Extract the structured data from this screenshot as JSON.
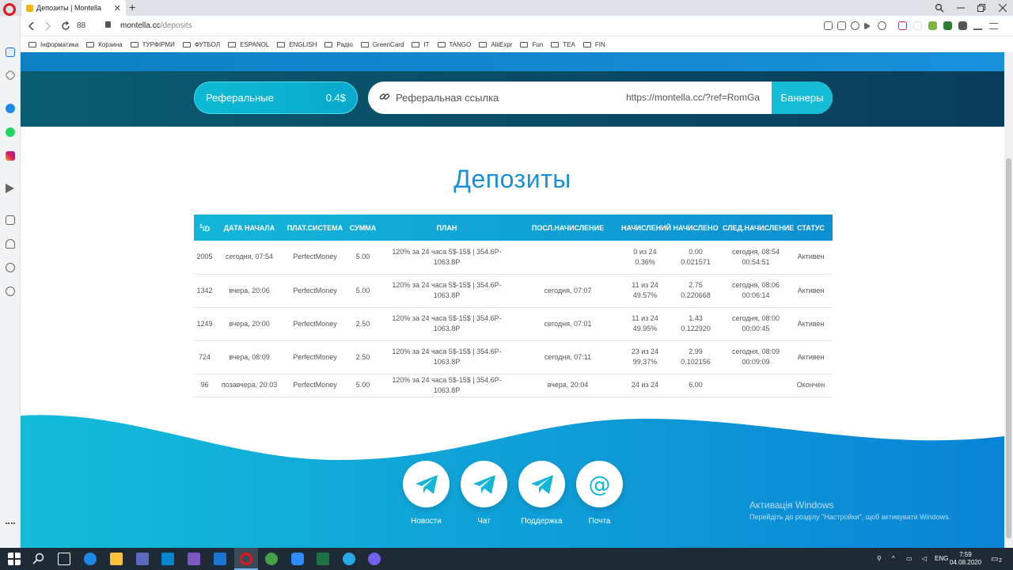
{
  "browser": {
    "tab_title": "Депозиты | Montella",
    "tab_close": "✕",
    "new_tab": "+",
    "speed_dial_count": "88",
    "url_host": "montella.cc",
    "url_path": "/deposits",
    "bookmarks": [
      "Інформатика",
      "Корзина",
      "ТУРФІРМИ",
      "ФУТБОЛ",
      "ESPANOL",
      "ENGLISH",
      "Радіо",
      "GreenCard",
      "IT",
      "TANGO",
      "AliiExpr",
      "Fun",
      "TEA",
      "FIN"
    ]
  },
  "referral": {
    "label": "Реферальные",
    "amount": "0.4$",
    "link_label": "Реферальная ссылка",
    "link_url": "https://montella.cc/?ref=RomGa",
    "banners_label": "Баннеры"
  },
  "page_title": "Депозиты",
  "table": {
    "headers": [
      "ID",
      "ДАТА НАЧАЛА",
      "ПЛАТ.СИСТЕМА",
      "СУММА",
      "ПЛАН",
      "ПОСЛ.НАЧИСЛЕНИЕ",
      "НАЧИСЛЕНИЙ",
      "НАЧИСЛЕНО",
      "СЛЕД.НАЧИСЛЕНИЕ",
      "СТАТУС"
    ],
    "id_prefix": "1",
    "rows": [
      {
        "id": "2005",
        "start": "сегодня, 07:54",
        "system": "PerfectMoney",
        "amount": "5.00",
        "plan": "120% за 24 часа 5$-15$ | 354.6P-1063.8P",
        "last": "",
        "count1": "0 из 24",
        "count2": "0.36%",
        "accr1": "0.00",
        "accr2": "0.021571",
        "next1": "сегодня, 08:54",
        "next2": "00:54:51",
        "status": "Активен"
      },
      {
        "id": "1342",
        "start": "вчера, 20:06",
        "system": "PerfectMoney",
        "amount": "5.00",
        "plan": "120% за 24 часа 5$-15$ | 354.6P-1063.8P",
        "last": "сегодня, 07:07",
        "count1": "11 из 24",
        "count2": "49.57%",
        "accr1": "2.75",
        "accr2": "0.220668",
        "next1": "сегодня, 08:06",
        "next2": "00:06:14",
        "status": "Активен"
      },
      {
        "id": "1249",
        "start": "вчера, 20:00",
        "system": "PerfectMoney",
        "amount": "2.50",
        "plan": "120% за 24 часа 5$-15$ | 354.6P-1063.8P",
        "last": "сегодня, 07:01",
        "count1": "11 из 24",
        "count2": "49.95%",
        "accr1": "1.43",
        "accr2": "0.122920",
        "next1": "сегодня, 08:00",
        "next2": "00:00:45",
        "status": "Активен"
      },
      {
        "id": "724",
        "start": "вчера, 08:09",
        "system": "PerfectMoney",
        "amount": "2.50",
        "plan": "120% за 24 часа 5$-15$ | 354.6P-1063.8P",
        "last": "сегодня, 07:11",
        "count1": "23 из 24",
        "count2": "99.37%",
        "accr1": "2.99",
        "accr2": "0.102156",
        "next1": "сегодня, 08:09",
        "next2": "00:09:09",
        "status": "Активен"
      },
      {
        "id": "96",
        "start": "позавчера, 20:03",
        "system": "PerfectMoney",
        "amount": "5.00",
        "plan": "120% за 24 часа 5$-15$ | 354.6P-1063.8P",
        "last": "вчера, 20:04",
        "count1": "24 из 24",
        "count2": "",
        "accr1": "6.00",
        "accr2": "",
        "next1": "",
        "next2": "",
        "status": "Окончен"
      }
    ]
  },
  "footer": {
    "links": [
      {
        "label": "Новости",
        "icon": "telegram-icon"
      },
      {
        "label": "Чат",
        "icon": "telegram-icon"
      },
      {
        "label": "Поддержка",
        "icon": "telegram-icon"
      },
      {
        "label": "Почта",
        "icon": "at-icon"
      }
    ]
  },
  "windows_activation": {
    "title": "Активація Windows",
    "subtitle": "Перейдіть до розділу \"Настройки\", щоб активувати Windows."
  },
  "taskbar": {
    "language": "ENG",
    "time": "7:59",
    "date": "04.08.2020",
    "notification_count": "2"
  },
  "colors": {
    "accent": "#1a90d8",
    "cyan": "#14b6d8",
    "dark_band": "#0a4c66",
    "status_active": "#555555"
  }
}
